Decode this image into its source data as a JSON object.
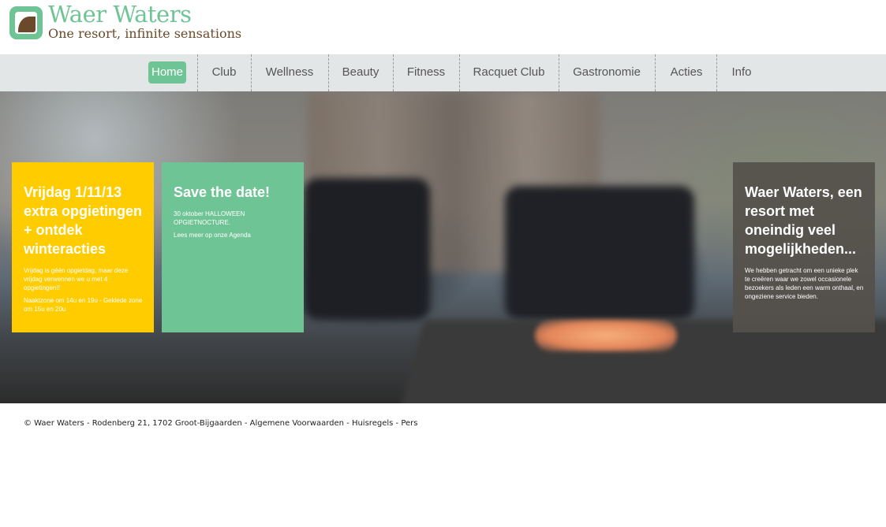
{
  "logo": {
    "title": "Waer Waters",
    "tagline": "One resort, infinite sensations"
  },
  "nav": {
    "items": [
      {
        "label": "Home",
        "active": true
      },
      {
        "label": "Club"
      },
      {
        "label": "Wellness"
      },
      {
        "label": "Beauty"
      },
      {
        "label": "Fitness"
      },
      {
        "label": "Racquet Club"
      },
      {
        "label": "Gastronomie"
      },
      {
        "label": "Acties"
      },
      {
        "label": "Info"
      }
    ]
  },
  "cards": [
    {
      "title": "Vrijdag 1/11/13 extra opgietingen + ontdek winteracties",
      "paragraphs": [
        "Vrijdag is géén opgietdag, maar deze vrijdag verwennen we u met 4 opgietingen!!",
        "Naaktzone om 14u en 19u - Geklede zone om 15u en 20u"
      ]
    },
    {
      "title": "Save the date!",
      "paragraphs": [
        "30 oktober HALLOWEEN OPGIETNOCTURE.",
        "Lees meer op onze Agenda"
      ]
    },
    {
      "title": "Waer Waters, een resort met oneindig veel mogelijkheden...",
      "paragraphs": [
        "We hebben getracht om een unieke plek te creëren waar we zowel occasionele bezoekers als leden een warm onthaal, en ongeziene service bieden."
      ]
    }
  ],
  "footer": {
    "copyright": "© Waer Waters - Rodenberg 21, 1702 Groot-Bijgaarden - ",
    "link_terms": "Algemene Voorwaarden",
    "sep1": " - ",
    "link_rules": "Huisregels",
    "sep2": " - ",
    "link_press": "Pers"
  },
  "colors": {
    "brand_green": "#6fc495",
    "brand_brown": "#6b4a2b",
    "card_yellow": "#ffcc00",
    "card_dark": "#55504b"
  },
  "icons": {
    "logo": "leaf-logo-icon"
  }
}
